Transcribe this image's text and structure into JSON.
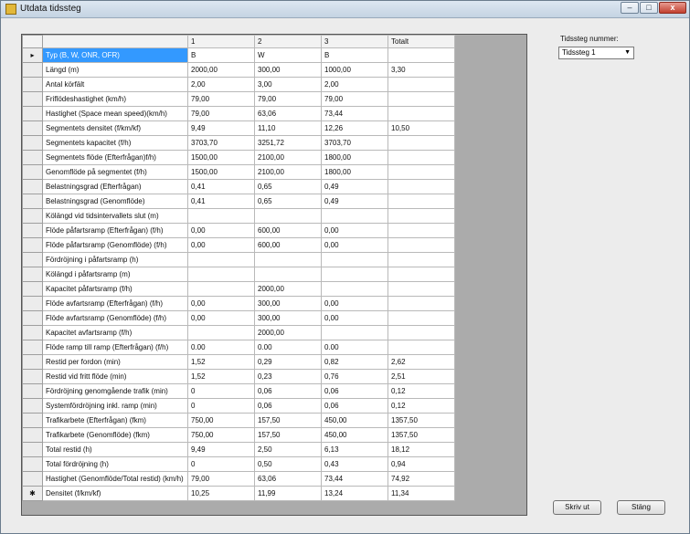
{
  "window": {
    "title": "Utdata tidssteg",
    "minimize": "–",
    "maximize": "□",
    "close": "x"
  },
  "grid": {
    "row_header_current": "▸",
    "row_header_new": "✱",
    "columns": [
      "",
      "1",
      "2",
      "3",
      "Totalt"
    ],
    "rows": [
      [
        "Typ (B, W, ONR, OFR)",
        "B",
        "W",
        "B",
        ""
      ],
      [
        "Längd (m)",
        "2000,00",
        "300,00",
        "1000,00",
        "3,30"
      ],
      [
        "Antal körfält",
        "2,00",
        "3,00",
        "2,00",
        ""
      ],
      [
        "Friflödeshastighet (km/h)",
        "79,00",
        "79,00",
        "79,00",
        ""
      ],
      [
        "Hastighet (Space mean speed)(km/h)",
        "79,00",
        "63,06",
        "73,44",
        ""
      ],
      [
        "Segmentets densitet (f/km/kf)",
        "9,49",
        "11,10",
        "12,26",
        "10,50"
      ],
      [
        "Segmentets kapacitet (f/h)",
        "3703,70",
        "3251,72",
        "3703,70",
        ""
      ],
      [
        "Segmentets flöde (Efterfrågan)f/h)",
        "1500,00",
        "2100,00",
        "1800,00",
        ""
      ],
      [
        "Genomflöde på segmentet (f/h)",
        "1500,00",
        "2100,00",
        "1800,00",
        ""
      ],
      [
        "Belastningsgrad (Efterfrågan)",
        "0,41",
        "0,65",
        "0,49",
        ""
      ],
      [
        "Belastningsgrad (Genomflöde)",
        "0,41",
        "0,65",
        "0,49",
        ""
      ],
      [
        "Kölängd vid tidsintervallets slut (m)",
        "",
        "",
        "",
        ""
      ],
      [
        "Flöde påfartsramp (Efterfrågan) (f/h)",
        "0,00",
        "600,00",
        "0,00",
        ""
      ],
      [
        "Flöde påfartsramp (Genomflöde) (f/h)",
        "0,00",
        "600,00",
        "0,00",
        ""
      ],
      [
        "Fördröjning i påfartsramp (h)",
        "",
        "",
        "",
        ""
      ],
      [
        "Kölängd i påfartsramp (m)",
        "",
        "",
        "",
        ""
      ],
      [
        "Kapacitet påfartsramp (f/h)",
        "",
        "2000,00",
        "",
        ""
      ],
      [
        "Flöde avfartsramp (Efterfrågan) (f/h)",
        "0,00",
        "300,00",
        "0,00",
        ""
      ],
      [
        "Flöde avfartsramp (Genomflöde) (f/h)",
        "0,00",
        "300,00",
        "0,00",
        ""
      ],
      [
        "Kapacitet avfartsramp (f/h)",
        "",
        "2000,00",
        "",
        ""
      ],
      [
        "Flöde ramp till ramp (Efterfrågan) (f/h)",
        "0.00",
        "0.00",
        "0.00",
        ""
      ],
      [
        "Restid per fordon (min)",
        "1,52",
        "0,29",
        "0,82",
        "2,62"
      ],
      [
        "Restid vid fritt flöde (min)",
        "1,52",
        "0,23",
        "0,76",
        "2,51"
      ],
      [
        "Fördröjning genomgående trafik (min)",
        "0",
        "0,06",
        "0,06",
        "0,12"
      ],
      [
        "Systemfördröjning inkl. ramp (min)",
        "0",
        "0,06",
        "0,06",
        "0,12"
      ],
      [
        "Trafikarbete (Efterfrågan) (fkm)",
        "750,00",
        "157,50",
        "450,00",
        "1357,50"
      ],
      [
        "Trafikarbete (Genomflöde) (fkm)",
        "750,00",
        "157,50",
        "450,00",
        "1357,50"
      ],
      [
        "Total restid (h)",
        "9,49",
        "2,50",
        "6,13",
        "18,12"
      ],
      [
        "Total fördröjning (h)",
        "0",
        "0,50",
        "0,43",
        "0,94"
      ],
      [
        "Hastighet (Genomflöde/Total restid) (km/h)",
        "79,00",
        "63,06",
        "73,44",
        "74,92"
      ],
      [
        "Densitet (f/km/kf)",
        "10,25",
        "11,99",
        "13,24",
        "11,34"
      ]
    ]
  },
  "side": {
    "label": "Tidssteg nummer:",
    "selected": "Tidssteg 1",
    "arrow": "▼"
  },
  "buttons": {
    "print": "Skriv ut",
    "close": "Stäng"
  },
  "colors": {
    "selection": "#3399ff"
  }
}
